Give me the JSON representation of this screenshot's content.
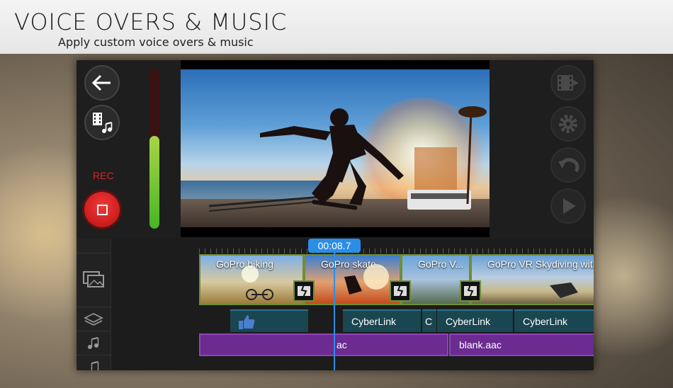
{
  "header": {
    "title": "VOICE OVERS & MUSIC",
    "subtitle": "Apply custom voice overs & music"
  },
  "left_panel": {
    "back_icon": "arrow-left-icon",
    "media_icon": "video-music-icon",
    "rec_label": "REC",
    "rec_icon": "stop-icon",
    "level_meter": 0.58
  },
  "right_panel": {
    "icons": [
      "export-icon",
      "gear-icon",
      "undo-icon",
      "play-icon"
    ]
  },
  "timeline": {
    "time": "00:08.7",
    "track_icons": [
      "image-icon",
      "layers-icon",
      "music-note-icon",
      "music-note-icon"
    ],
    "video_clips": [
      {
        "label": "GoPro biking"
      },
      {
        "label": "GoPro skate..."
      },
      {
        "label": "GoPro V..."
      },
      {
        "label": "GoPro VR  Skydiving with"
      }
    ],
    "text_clips": [
      {
        "label": ""
      },
      {
        "label": "CyberLink"
      },
      {
        "label": "C"
      },
      {
        "label": "CyberLink"
      },
      {
        "label": "CyberLink"
      }
    ],
    "audio_clips": [
      {
        "label": "ac"
      },
      {
        "label": "blank.aac"
      }
    ]
  },
  "colors": {
    "accent": "#2b8ee6",
    "rec": "#e02020",
    "clip_border": "#6f8d3a",
    "audio": "#6b2b91",
    "text_track": "#1a4651"
  }
}
